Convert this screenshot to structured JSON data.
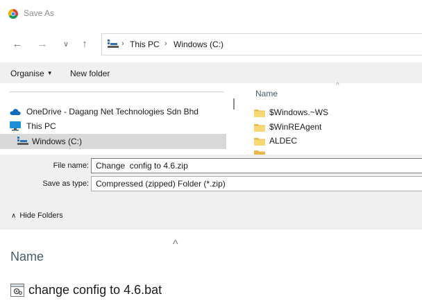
{
  "window": {
    "title": "Save As",
    "icon": "chrome-icon"
  },
  "nav": {
    "back_icon": "arrow-left-icon",
    "forward_icon": "arrow-right-icon",
    "recent_icon": "chevron-down-icon",
    "up_icon": "arrow-up-icon",
    "breadcrumbs": [
      "This PC",
      "Windows (C:)"
    ],
    "breadcrumb_separator": "›"
  },
  "toolbar": {
    "organise_label": "Organise",
    "new_folder_label": "New folder"
  },
  "nav_pane": {
    "items": [
      {
        "label": "OneDrive - Dagang Net Technologies Sdn Bhd",
        "icon": "onedrive-cloud-icon",
        "selected": false
      },
      {
        "label": "This PC",
        "icon": "monitor-icon",
        "selected": false
      },
      {
        "label": "Windows (C:)",
        "icon": "drive-icon",
        "selected": true
      }
    ]
  },
  "file_pane": {
    "column_header": "Name",
    "files": [
      {
        "name": "$Windows.~WS",
        "icon": "folder-icon"
      },
      {
        "name": "$WinREAgent",
        "icon": "folder-icon"
      },
      {
        "name": "ALDEC",
        "icon": "folder-icon"
      }
    ]
  },
  "form": {
    "file_name_label": "File name:",
    "file_name_value": "Change  config to 4.6.zip",
    "save_type_label": "Save as type:",
    "save_type_value": "Compressed (zipped) Folder (*.zip)"
  },
  "hide_folders": {
    "label": "Hide Folders"
  },
  "background": {
    "column_header": "Name",
    "file_name": "change  config to 4.6.bat",
    "file_icon": "batch-file-icon"
  },
  "colors": {
    "folder": "#f8d775",
    "selection": "#d9d9d9",
    "dialog_bg": "#f0f0f0",
    "onedrive": "#0f6cbd",
    "monitor": "#1e8fd6"
  }
}
